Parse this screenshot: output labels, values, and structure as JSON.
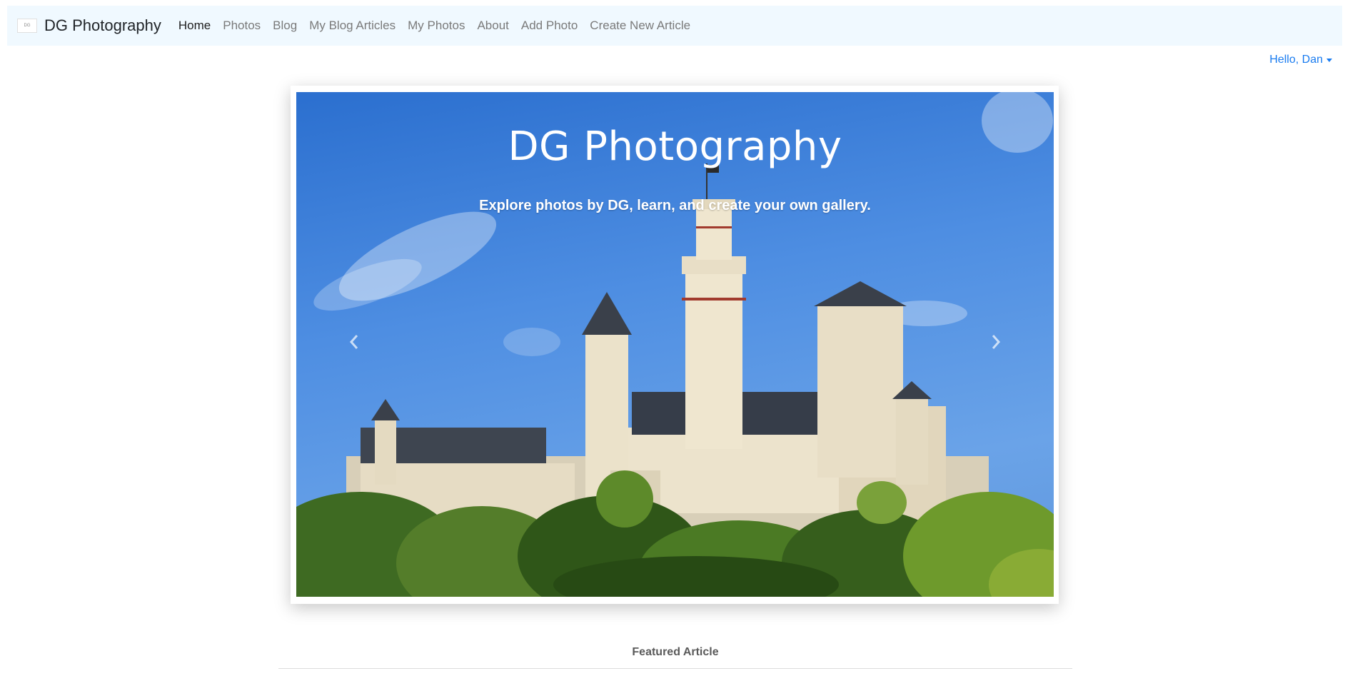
{
  "brand": {
    "name": "DG Photography",
    "logo_text": "DG"
  },
  "nav": {
    "items": [
      {
        "label": "Home",
        "active": true
      },
      {
        "label": "Photos"
      },
      {
        "label": "Blog"
      },
      {
        "label": "My Blog Articles"
      },
      {
        "label": "My Photos"
      },
      {
        "label": "About"
      },
      {
        "label": "Add Photo"
      },
      {
        "label": "Create New Article"
      }
    ]
  },
  "user_menu": {
    "label": "Hello, Dan",
    "icon": "caret-down-icon"
  },
  "carousel": {
    "title": "DG Photography",
    "subtitle": "Explore photos by DG, learn, and create your own gallery.",
    "prev_icon": "chevron-left-icon",
    "next_icon": "chevron-right-icon",
    "image_subject": "castle-photo"
  },
  "featured": {
    "label": "Featured Article"
  },
  "colors": {
    "navbar_bg": "#f0f9ff",
    "link_blue": "#1a7cf0",
    "nav_inactive": "#7a7a7a",
    "nav_active": "#1e1e1e"
  }
}
